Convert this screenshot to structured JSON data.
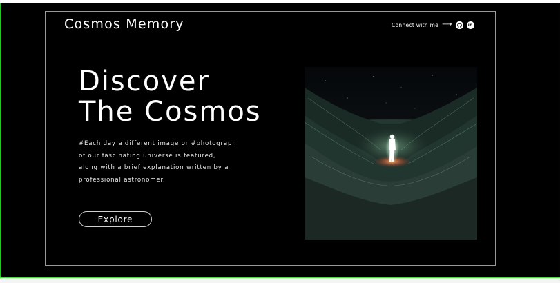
{
  "header": {
    "brand": "Cosmos Memory",
    "connect_label": "Connect with me",
    "social": [
      {
        "icon": "github-icon",
        "glyph": "●"
      },
      {
        "icon": "linkedin-icon",
        "glyph": "in"
      }
    ]
  },
  "hero": {
    "title_line1": "Discover",
    "title_line2": "The Cosmos",
    "description_lines": [
      "#Each day a different image or #photograph",
      "of our fascinating universe is featured,",
      "along with a brief explanation written by a",
      "professional astronomer."
    ],
    "cta_label": "Explore",
    "image_icon": "astronaut-canyon-image"
  },
  "colors": {
    "background": "#000000",
    "text": "#ffffff",
    "frame_border": "#9a9a9a",
    "accent_glow": "#e07a4a"
  }
}
